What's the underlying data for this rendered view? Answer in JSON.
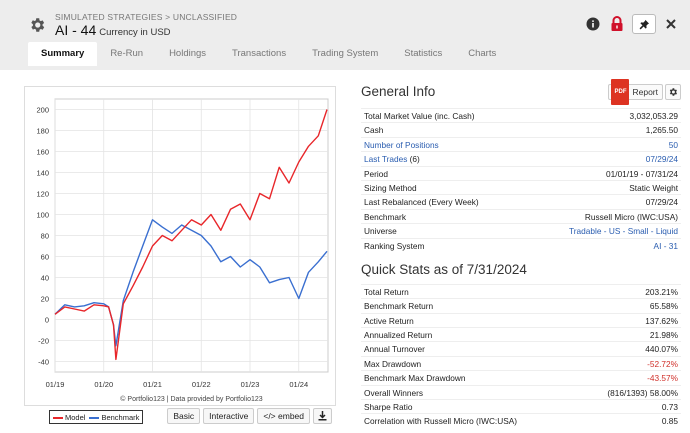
{
  "header": {
    "breadcrumb": "SIMULATED STRATEGIES > UNCLASSIFIED",
    "title": "AI - 44",
    "currency": "Currency in USD"
  },
  "tabs": [
    "Summary",
    "Re-Run",
    "Holdings",
    "Transactions",
    "Trading System",
    "Statistics",
    "Charts"
  ],
  "chart_footer": {
    "credit": "© Portfolio123 | Data provided by Portfolio123",
    "legend_model": "Model",
    "legend_benchmark": "Benchmark",
    "btn_basic": "Basic",
    "btn_interactive": "Interactive",
    "btn_embed": "</> embed"
  },
  "chart_data": {
    "type": "line",
    "x_labels": [
      "01/19",
      "01/20",
      "01/21",
      "01/22",
      "01/23",
      "01/24"
    ],
    "y_ticks": [
      200,
      180,
      160,
      140,
      120,
      100,
      80,
      60,
      40,
      20,
      0,
      -20,
      -40
    ],
    "ylim": [
      -50,
      210
    ],
    "grid": true,
    "legend_position": "bottom-left",
    "colors": {
      "model": "#e8262a",
      "benchmark": "#3a6fd0"
    },
    "series": [
      {
        "name": "Model",
        "x": [
          2019.0,
          2019.2,
          2019.4,
          2019.6,
          2019.8,
          2020.0,
          2020.1,
          2020.2,
          2020.25,
          2020.4,
          2020.6,
          2020.8,
          2021.0,
          2021.2,
          2021.4,
          2021.6,
          2021.8,
          2022.0,
          2022.2,
          2022.4,
          2022.6,
          2022.8,
          2023.0,
          2023.2,
          2023.4,
          2023.6,
          2023.8,
          2024.0,
          2024.2,
          2024.4,
          2024.58
        ],
        "values": [
          5,
          12,
          10,
          8,
          14,
          13,
          12,
          -5,
          -38,
          15,
          32,
          50,
          70,
          80,
          75,
          85,
          95,
          90,
          100,
          85,
          105,
          110,
          95,
          120,
          115,
          145,
          130,
          150,
          165,
          175,
          200
        ]
      },
      {
        "name": "Benchmark",
        "x": [
          2019.0,
          2019.2,
          2019.4,
          2019.6,
          2019.8,
          2020.0,
          2020.1,
          2020.2,
          2020.25,
          2020.4,
          2020.6,
          2020.8,
          2021.0,
          2021.2,
          2021.4,
          2021.6,
          2021.8,
          2022.0,
          2022.2,
          2022.4,
          2022.6,
          2022.8,
          2023.0,
          2023.2,
          2023.4,
          2023.6,
          2023.8,
          2024.0,
          2024.2,
          2024.4,
          2024.58
        ],
        "values": [
          5,
          14,
          12,
          13,
          16,
          15,
          12,
          -5,
          -25,
          18,
          45,
          70,
          95,
          88,
          82,
          90,
          85,
          80,
          70,
          55,
          60,
          50,
          57,
          50,
          35,
          38,
          40,
          20,
          45,
          55,
          65
        ]
      }
    ]
  },
  "general_info": {
    "title": "General Info",
    "report_label": "Report",
    "pdf_label": "PDF",
    "rows": [
      {
        "label": "Total Market Value (inc. Cash)",
        "value": "3,032,053.29"
      },
      {
        "label": "Cash",
        "value": "1,265.50"
      },
      {
        "label": "Number of Positions",
        "value": "50"
      },
      {
        "label": "Last Trades",
        "count": "(6)",
        "value": "07/29/24"
      },
      {
        "label": "Period",
        "value": "01/01/19 - 07/31/24"
      },
      {
        "label": "Sizing Method",
        "value": "Static Weight"
      },
      {
        "label": "Last Rebalanced (Every Week)",
        "value": "07/29/24"
      },
      {
        "label": "Benchmark",
        "value": "Russell Micro (IWC:USA)"
      },
      {
        "label": "Universe",
        "value": "Tradable - US - Small - Liquid"
      },
      {
        "label": "Ranking System",
        "value": "AI - 31"
      }
    ]
  },
  "quick_stats": {
    "title": "Quick Stats as of 7/31/2024",
    "rows": [
      {
        "label": "Total Return",
        "value": "203.21%"
      },
      {
        "label": "Benchmark Return",
        "value": "65.58%"
      },
      {
        "label": "Active Return",
        "value": "137.62%"
      },
      {
        "label": "Annualized Return",
        "value": "21.98%"
      },
      {
        "label": "Annual Turnover",
        "value": "440.07%"
      },
      {
        "label": "Max Drawdown",
        "value": "-52.72%"
      },
      {
        "label": "Benchmark Max Drawdown",
        "value": "-43.57%"
      },
      {
        "label": "Overall Winners",
        "value": "(816/1393) 58.00%"
      },
      {
        "label": "Sharpe Ratio",
        "value": "0.73"
      },
      {
        "label": "Correlation with Russell Micro (IWC:USA)",
        "value": "0.85"
      }
    ]
  }
}
